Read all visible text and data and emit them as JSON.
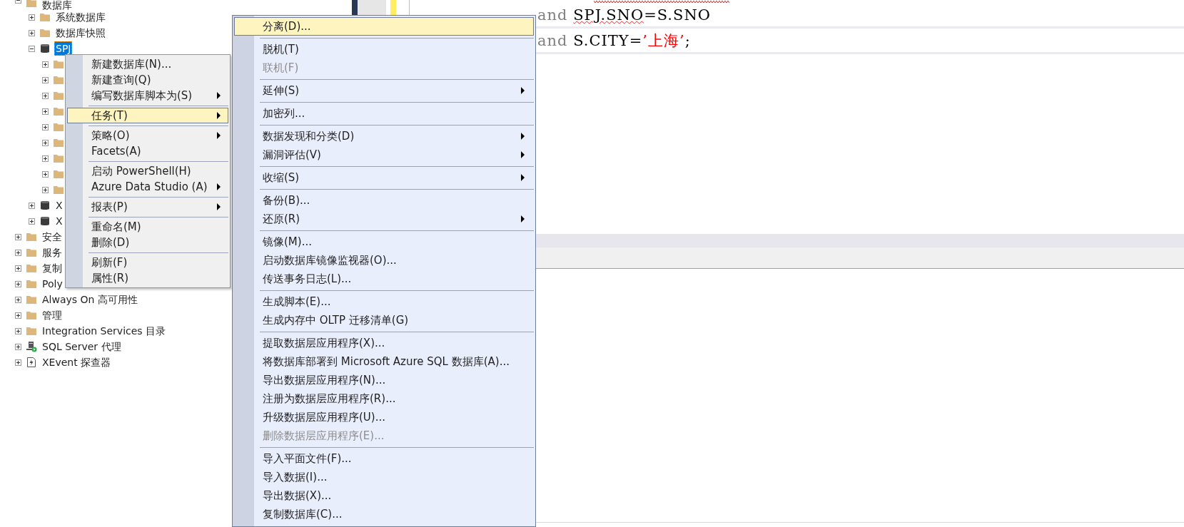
{
  "object_explorer": {
    "items": [
      {
        "label": "数据库",
        "kind": "folder",
        "expanded": true,
        "selected": false,
        "children": [
          {
            "label": "系统数据库",
            "kind": "folder",
            "expanded": false,
            "selected": false
          },
          {
            "label": "数据库快照",
            "kind": "folder",
            "expanded": false,
            "selected": false
          },
          {
            "label": "SPJ",
            "kind": "database",
            "expanded": true,
            "selected": true,
            "children": [
              {
                "kind": "folder",
                "expanded": false,
                "selected": false
              },
              {
                "kind": "folder",
                "expanded": false,
                "selected": false
              },
              {
                "kind": "folder",
                "expanded": false,
                "selected": false
              },
              {
                "kind": "folder",
                "expanded": false,
                "selected": false
              },
              {
                "kind": "folder",
                "expanded": false,
                "selected": false
              },
              {
                "kind": "folder",
                "expanded": false,
                "selected": false
              },
              {
                "kind": "folder",
                "expanded": false,
                "selected": false
              },
              {
                "kind": "folder",
                "expanded": false,
                "selected": false
              },
              {
                "kind": "folder",
                "expanded": false,
                "selected": false
              }
            ]
          },
          {
            "label": "X",
            "kind": "database",
            "expanded": false,
            "selected": false
          },
          {
            "label": "X",
            "kind": "database",
            "expanded": false,
            "selected": false
          }
        ]
      },
      {
        "label": "安全",
        "kind": "folder",
        "expanded": false,
        "selected": false
      },
      {
        "label": "服务",
        "kind": "folder",
        "expanded": false,
        "selected": false
      },
      {
        "label": "复制",
        "kind": "folder",
        "expanded": false,
        "selected": false
      },
      {
        "label": "Poly",
        "kind": "folder",
        "expanded": false,
        "selected": false
      },
      {
        "label": "Always On 高可用性",
        "kind": "folder",
        "expanded": false,
        "selected": false
      },
      {
        "label": "管理",
        "kind": "folder",
        "expanded": false,
        "selected": false
      },
      {
        "label": "Integration Services 目录",
        "kind": "folder",
        "expanded": false,
        "selected": false
      },
      {
        "label": "SQL Server 代理",
        "kind": "agent",
        "expanded": false,
        "selected": false
      },
      {
        "label": "XEvent 探查器",
        "kind": "xevent",
        "expanded": false,
        "selected": false
      }
    ]
  },
  "editor": {
    "lines": [
      {
        "kind": "cut_off",
        "misspelled": true
      },
      {
        "kind": "code",
        "tokens": [
          {
            "text": "and ",
            "kind": "keyword"
          },
          {
            "text": "SPJ.SNO",
            "kind": "plain",
            "misspelled": true
          },
          {
            "text": "=S.SNO",
            "kind": "plain"
          }
        ]
      },
      {
        "kind": "code",
        "tokens": [
          {
            "text": "and",
            "kind": "keyword"
          },
          {
            "text": " S.CITY=",
            "kind": "plain"
          },
          {
            "text": "’上海’",
            "kind": "string"
          },
          {
            "text": ";",
            "kind": "plain"
          }
        ]
      }
    ]
  },
  "context_menu": {
    "groups": [
      [
        {
          "label": "新建数据库(N)...",
          "submenu": false,
          "selected": false
        },
        {
          "label": "新建查询(Q)",
          "submenu": false,
          "selected": false
        },
        {
          "label": "编写数据库脚本为(S)",
          "submenu": true,
          "selected": false
        }
      ],
      [
        {
          "label": "任务(T)",
          "submenu": true,
          "selected": true
        }
      ],
      [
        {
          "label": "策略(O)",
          "submenu": true,
          "selected": false
        },
        {
          "label": "Facets(A)",
          "submenu": false,
          "selected": false
        }
      ],
      [
        {
          "label": "启动 PowerShell(H)",
          "submenu": false,
          "selected": false
        },
        {
          "label": "Azure Data Studio (A)",
          "submenu": true,
          "selected": false
        }
      ],
      [
        {
          "label": "报表(P)",
          "submenu": true,
          "selected": false
        }
      ],
      [
        {
          "label": "重命名(M)",
          "submenu": false,
          "selected": false
        },
        {
          "label": "删除(D)",
          "submenu": false,
          "selected": false
        }
      ],
      [
        {
          "label": "刷新(F)",
          "submenu": false,
          "selected": false
        },
        {
          "label": "属性(R)",
          "submenu": false,
          "selected": false
        }
      ]
    ]
  },
  "submenu": {
    "groups": [
      [
        {
          "label": "分离(D)...",
          "submenu": false,
          "selected": true,
          "disabled": false
        }
      ],
      [
        {
          "label": "脱机(T)",
          "submenu": false,
          "selected": false,
          "disabled": false
        },
        {
          "label": "联机(F)",
          "submenu": false,
          "selected": false,
          "disabled": true
        }
      ],
      [
        {
          "label": "延伸(S)",
          "submenu": true,
          "selected": false,
          "disabled": false
        }
      ],
      [
        {
          "label": "加密列...",
          "submenu": false,
          "selected": false,
          "disabled": false
        }
      ],
      [
        {
          "label": "数据发现和分类(D)",
          "submenu": true,
          "selected": false,
          "disabled": false
        },
        {
          "label": "漏洞评估(V)",
          "submenu": true,
          "selected": false,
          "disabled": false
        }
      ],
      [
        {
          "label": "收缩(S)",
          "submenu": true,
          "selected": false,
          "disabled": false
        }
      ],
      [
        {
          "label": "备份(B)...",
          "submenu": false,
          "selected": false,
          "disabled": false
        },
        {
          "label": "还原(R)",
          "submenu": true,
          "selected": false,
          "disabled": false
        }
      ],
      [
        {
          "label": "镜像(M)...",
          "submenu": false,
          "selected": false,
          "disabled": false
        },
        {
          "label": "启动数据库镜像监视器(O)...",
          "submenu": false,
          "selected": false,
          "disabled": false
        },
        {
          "label": "传送事务日志(L)...",
          "submenu": false,
          "selected": false,
          "disabled": false
        }
      ],
      [
        {
          "label": "生成脚本(E)...",
          "submenu": false,
          "selected": false,
          "disabled": false
        },
        {
          "label": "生成内存中 OLTP 迁移清单(G)",
          "submenu": false,
          "selected": false,
          "disabled": false
        }
      ],
      [
        {
          "label": "提取数据层应用程序(X)...",
          "submenu": false,
          "selected": false,
          "disabled": false
        },
        {
          "label": "将数据库部署到 Microsoft Azure SQL 数据库(A)...",
          "submenu": false,
          "selected": false,
          "disabled": false
        },
        {
          "label": "导出数据层应用程序(N)...",
          "submenu": false,
          "selected": false,
          "disabled": false
        },
        {
          "label": "注册为数据层应用程序(R)...",
          "submenu": false,
          "selected": false,
          "disabled": false
        },
        {
          "label": "升级数据层应用程序(U)...",
          "submenu": false,
          "selected": false,
          "disabled": false
        },
        {
          "label": "删除数据层应用程序(E)...",
          "submenu": false,
          "selected": false,
          "disabled": true
        }
      ],
      [
        {
          "label": "导入平面文件(F)...",
          "submenu": false,
          "selected": false,
          "disabled": false
        },
        {
          "label": "导入数据(I)...",
          "submenu": false,
          "selected": false,
          "disabled": false
        },
        {
          "label": "导出数据(X)...",
          "submenu": false,
          "selected": false,
          "disabled": false
        },
        {
          "label": "复制数据库(C)...",
          "submenu": false,
          "selected": false,
          "disabled": false
        }
      ]
    ]
  }
}
